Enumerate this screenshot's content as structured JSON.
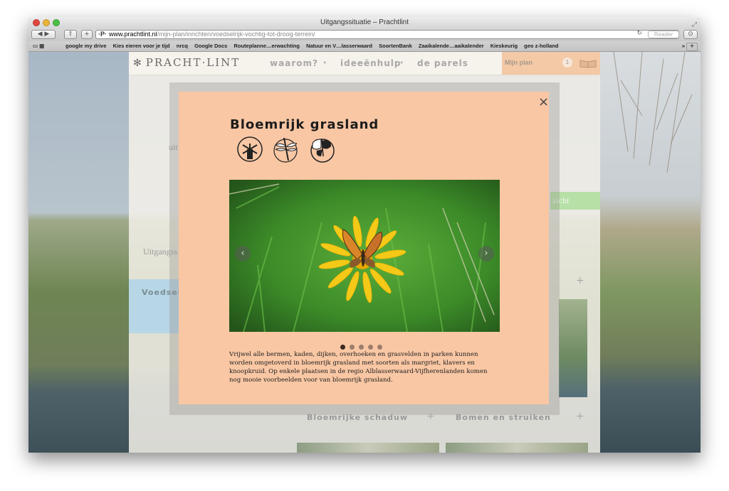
{
  "browser": {
    "title": "Uitgangssituatie – Prachtlint",
    "url_host": "www.prachtlint.nl",
    "url_path": "/mijn-plan/inrichten/voedselrijk-vochtig-tot-droog-terrein/",
    "reader_label": "Reader",
    "bookmarks": [
      "google my drive",
      "Kies eieren voor je tijd",
      "nrcq",
      "Google Docs",
      "Routeplanne…erwachting",
      "Natuur en V…lasserwaard",
      "SoortenBank",
      "Zaaikalende…aaikalender",
      "Kieskeurig",
      "geo z-holland"
    ],
    "bookmarks_more": "»"
  },
  "site": {
    "logo": "PRACHT·LINT",
    "nav": [
      "waarom?",
      "ideeënhulp",
      "de parels"
    ],
    "nav_sep": "•",
    "myplan_label": "Mijn plan",
    "myplan_count": "1"
  },
  "background_page": {
    "side_text_1": "uit",
    "side_text_2": "Uitgangss",
    "green_button_text": "zicht",
    "blue_panel_text": "Voedselr",
    "cards": [
      {
        "title": "Bloemrijke schaduw",
        "plus": "+"
      },
      {
        "title": "Bomen en struiken",
        "plus": "+"
      }
    ],
    "right_card_plus": "+"
  },
  "modal": {
    "title": "Bloemrijk grasland",
    "close_glyph": "×",
    "description": "Vrijwel alle bermen, kaden, dijken, overhoeken en grasvelden in parken kunnen worden omgetoverd in bloemrijk grasland met soorten als margriet, klavers en knoopkruid. Op enkele plaatsen in de regio Alblasserwaard-Vijfherenlanden komen nog mooie voorbeelden voor van bloemrijk grasland.",
    "slide_count": 5,
    "active_slide": 1,
    "prev_glyph": "‹",
    "next_glyph": "›",
    "badge_icons": [
      "windmill-icon",
      "dragonfly-icon",
      "butterfly-icon"
    ]
  }
}
